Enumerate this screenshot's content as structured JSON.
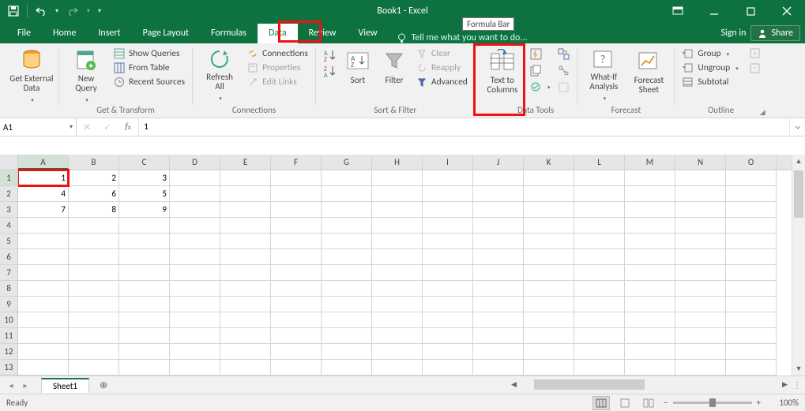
{
  "title": "Book1 - Excel",
  "tabs": {
    "file": "File",
    "home": "Home",
    "insert": "Insert",
    "pagelayout": "Page Layout",
    "formulas": "Formulas",
    "data": "Data",
    "review": "Review",
    "view": "View"
  },
  "tell": "Tell me what you want to do...",
  "signin": "Sign in",
  "share": "Share",
  "ribbon": {
    "getexternal": "Get External\nData",
    "newquery": "New\nQuery",
    "showqueries": "Show Queries",
    "fromtable": "From Table",
    "recentsources": "Recent Sources",
    "gt_label": "Get & Transform",
    "refresh": "Refresh\nAll",
    "connections": "Connections",
    "properties": "Properties",
    "editlinks": "Edit Links",
    "conn_label": "Connections",
    "sort": "Sort",
    "filter": "Filter",
    "clear": "Clear",
    "reapply": "Reapply",
    "advanced": "Advanced",
    "sf_label": "Sort & Filter",
    "ttc": "Text to\nColumns",
    "dt_label": "Data Tools",
    "whatif": "What-If\nAnalysis",
    "forecast": "Forecast\nSheet",
    "fc_label": "Forecast",
    "group": "Group",
    "ungroup": "Ungroup",
    "subtotal": "Subtotal",
    "ol_label": "Outline"
  },
  "namebox": "A1",
  "formula": "1",
  "tooltip": "Formula Bar",
  "cols": [
    "A",
    "B",
    "C",
    "D",
    "E",
    "F",
    "G",
    "H",
    "I",
    "J",
    "K",
    "L",
    "M",
    "N",
    "O"
  ],
  "grid": [
    [
      "1",
      "2",
      "3"
    ],
    [
      "4",
      "6",
      "5"
    ],
    [
      "7",
      "8",
      "9"
    ]
  ],
  "sheet": "Sheet1",
  "ready": "Ready",
  "zoom": "100%",
  "chart_data": {
    "type": "table",
    "columns": [
      "A",
      "B",
      "C"
    ],
    "rows": [
      [
        "1",
        "2",
        "3"
      ],
      [
        "4",
        "6",
        "5"
      ],
      [
        "7",
        "8",
        "9"
      ]
    ]
  }
}
